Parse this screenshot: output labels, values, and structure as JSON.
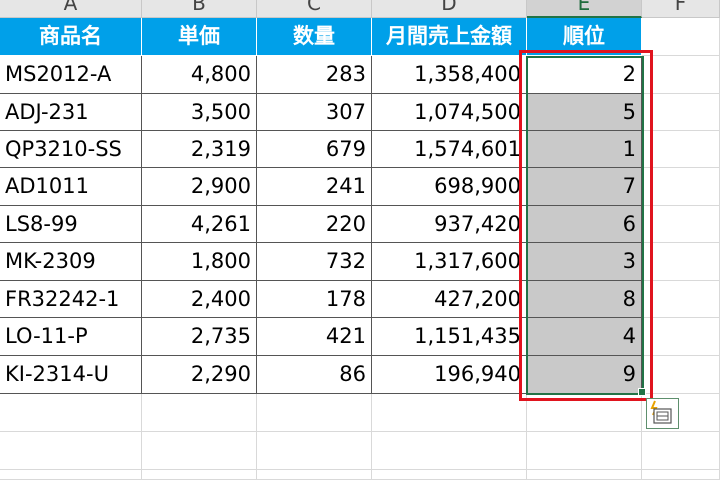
{
  "column_headers": [
    "A",
    "B",
    "C",
    "D",
    "E",
    "F"
  ],
  "selected_column": "E",
  "table": {
    "headers": [
      "商品名",
      "単価",
      "数量",
      "月間売上金額",
      "順位"
    ],
    "rows": [
      [
        "MS2012-A",
        "4,800",
        "283",
        "1,358,400",
        "2"
      ],
      [
        "ADJ-231",
        "3,500",
        "307",
        "1,074,500",
        "5"
      ],
      [
        "QP3210-SS",
        "2,319",
        "679",
        "1,574,601",
        "1"
      ],
      [
        "AD1011",
        "2,900",
        "241",
        "698,900",
        "7"
      ],
      [
        "LS8-99",
        "4,261",
        "220",
        "937,420",
        "6"
      ],
      [
        "MK-2309",
        "1,800",
        "732",
        "1,317,600",
        "3"
      ],
      [
        "FR32242-1",
        "2,400",
        "178",
        "427,200",
        "8"
      ],
      [
        "LO-11-P",
        "2,735",
        "421",
        "1,151,435",
        "4"
      ],
      [
        "KI-2314-U",
        "2,290",
        "86",
        "196,940",
        "9"
      ]
    ]
  },
  "colors": {
    "header_fill": "#00a0e9",
    "header_text": "#ffffff",
    "selection_fill": "#c9c9c9",
    "selection_border": "#217346",
    "highlight_box": "#e0141e"
  },
  "icons": {
    "quick_analysis": "flash-fill-options-icon"
  }
}
